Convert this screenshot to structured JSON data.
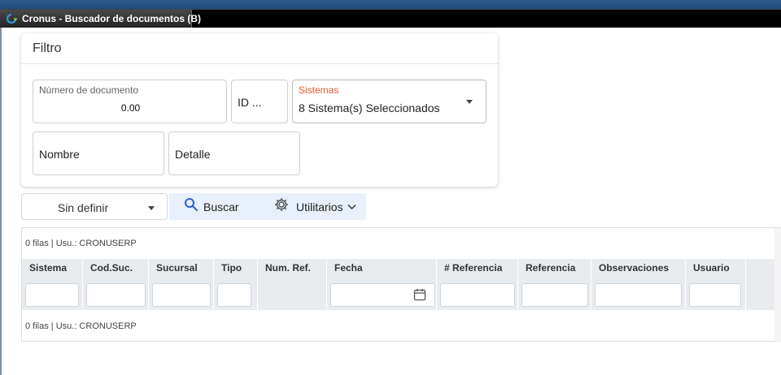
{
  "window": {
    "title": "Cronus - Buscador de documentos (B)",
    "app_icon": "cronus-logo-icon"
  },
  "filter": {
    "title": "Filtro",
    "numero_documento": {
      "label": "Número de documento",
      "value": "0.00"
    },
    "id_field": {
      "value": "ID ..."
    },
    "sistemas": {
      "label": "Sistemas",
      "value": "8 Sistema(s) Seleccionados",
      "label_color": "#e65a2f"
    },
    "nombre": {
      "placeholder": "Nombre"
    },
    "detalle": {
      "placeholder": "Detalle"
    }
  },
  "toolbar": {
    "selector_value": "Sin definir",
    "search_label": "Buscar",
    "utilities_label": "Utilitarios",
    "toolbar_bg": "#e8f0fb",
    "search_icon_color": "#2f5fd0"
  },
  "grid": {
    "rows_info_top": "0 filas | Usu.: CRONUSERP",
    "rows_info_bottom": "0 filas | Usu.: CRONUSERP",
    "columns": [
      {
        "label": "Sistema",
        "filter": "text"
      },
      {
        "label": "Cod.Suc.",
        "filter": "text"
      },
      {
        "label": "Sucursal",
        "filter": "text"
      },
      {
        "label": "Tipo",
        "filter": "text"
      },
      {
        "label": "Num. Ref.",
        "filter": "none"
      },
      {
        "label": "Fecha",
        "filter": "date"
      },
      {
        "label": "# Referencia",
        "filter": "text"
      },
      {
        "label": "Referencia",
        "filter": "text"
      },
      {
        "label": "Observaciones",
        "filter": "text"
      },
      {
        "label": "Usuario",
        "filter": "text"
      }
    ]
  }
}
